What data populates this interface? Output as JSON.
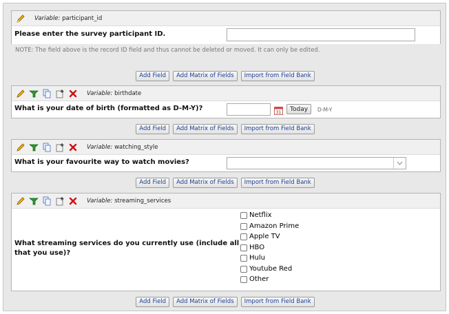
{
  "fields": {
    "participant": {
      "variable_prefix": "Variable:",
      "variable": "participant_id",
      "question": "Please enter the survey participant ID.",
      "note": "NOTE: The field above is the record ID field and thus cannot be deleted or moved. It can only be edited.",
      "value": ""
    },
    "birthdate": {
      "variable_prefix": "Variable:",
      "variable": "birthdate",
      "question": "What is your date of birth (formatted as D-M-Y)?",
      "value": "",
      "today_label": "Today",
      "format_hint": "D-M-Y"
    },
    "watching_style": {
      "variable_prefix": "Variable:",
      "variable": "watching_style",
      "question": "What is your favourite way to watch movies?",
      "selected": ""
    },
    "streaming_services": {
      "variable_prefix": "Variable:",
      "variable": "streaming_services",
      "question_line1": "What streaming services do you currently use (include all",
      "question_line2": "that you use)?",
      "options": [
        "Netflix",
        "Amazon Prime",
        "Apple TV",
        "HBO",
        "Hulu",
        "Youtube Red",
        "Other"
      ]
    }
  },
  "buttons": {
    "add_field": "Add Field",
    "add_matrix": "Add Matrix of Fields",
    "import_bank": "Import from Field Bank"
  },
  "icons": [
    "pencil-icon",
    "branching-icon",
    "copy-icon",
    "move-icon",
    "delete-icon",
    "calendar-icon",
    "dropdown-arrow-icon"
  ],
  "colors": {
    "button_text": "#1a3d8f",
    "delete": "#cc1111",
    "branching": "#2a9a2a",
    "pencil": "#e0a000"
  }
}
